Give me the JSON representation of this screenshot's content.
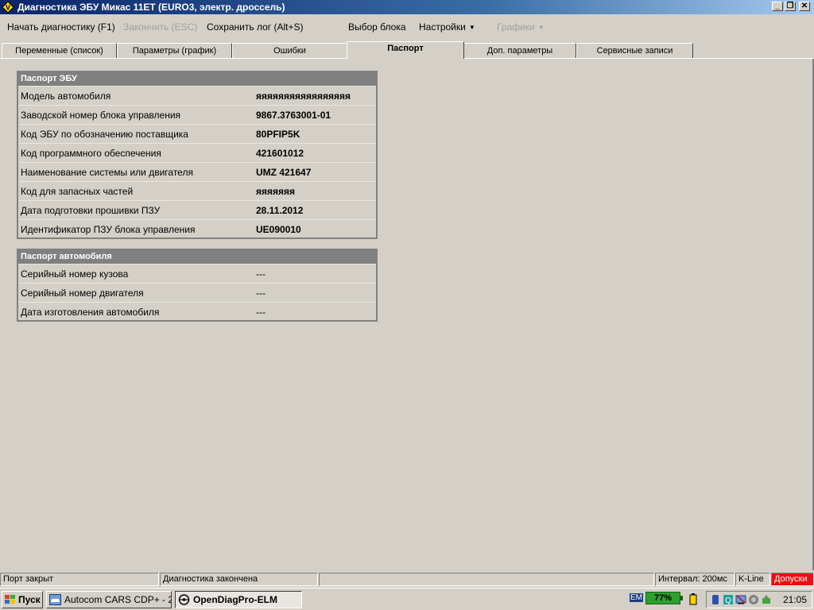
{
  "window": {
    "title": "Диагностика ЭБУ Микас 11ЕТ (EURO3, электр. дроссель)",
    "minimize_glyph": "_",
    "restore_glyph": "❐",
    "close_glyph": "✕"
  },
  "menu": {
    "start_diag": "Начать диагностику (F1)",
    "stop_diag": "Закончить (ESC)",
    "save_log": "Сохранить лог (Alt+S)",
    "select_block": "Выбор блока",
    "settings": "Настройки",
    "graphs": "Графики"
  },
  "tabs": [
    {
      "label": "Переменные (список)"
    },
    {
      "label": "Параметры (график)"
    },
    {
      "label": "Ошибки"
    },
    {
      "label": "Паспорт",
      "active": true
    },
    {
      "label": "Доп. параметры"
    },
    {
      "label": "Сервисные записи"
    }
  ],
  "ecu_passport": {
    "header": "Паспорт ЭБУ",
    "rows": [
      {
        "name": "Модель автомобиля",
        "value": "яяяяяяяяяяяяяяяяя"
      },
      {
        "name": "Заводской номер блока управления",
        "value": "9867.3763001-01"
      },
      {
        "name": "Код ЭБУ по обозначению поставщика",
        "value": "80PFIP5K"
      },
      {
        "name": "Код программного обеспечения",
        "value": "421601012"
      },
      {
        "name": "Наименование системы или двигателя",
        "value": "UMZ 421647"
      },
      {
        "name": "Код для запасных частей",
        "value": "яяяяяяя"
      },
      {
        "name": "Дата подготовки прошивки ПЗУ",
        "value": "28.11.2012"
      },
      {
        "name": "Идентификатор ПЗУ блока управления",
        "value": "UE090010"
      }
    ]
  },
  "car_passport": {
    "header": "Паспорт автомобиля",
    "rows": [
      {
        "name": "Серийный номер кузова",
        "value": "---"
      },
      {
        "name": "Серийный номер двигателя",
        "value": "---"
      },
      {
        "name": "Дата изготовления автомобиля",
        "value": "---"
      }
    ]
  },
  "status": {
    "port": "Порт закрыт",
    "diag": "Диагностика закончена",
    "blank": "",
    "interval": "Интервал: 200мс",
    "protocol": "K-Line",
    "limits": "Допуски",
    "limits_color": "#e81010"
  },
  "taskbar": {
    "start": "Пуск",
    "tasks": [
      {
        "label": "Autocom CARS CDP+ - 2..."
      },
      {
        "label": "OpenDiagPro-ELM",
        "active": true
      }
    ],
    "tray_em": "EM",
    "battery": "77%",
    "battery_color": "#2ca02c",
    "clock": "21:05"
  },
  "colors": {
    "title_bar": "#0a246a",
    "panel_header": "#808080",
    "window_bg": "#d4d0c8"
  }
}
